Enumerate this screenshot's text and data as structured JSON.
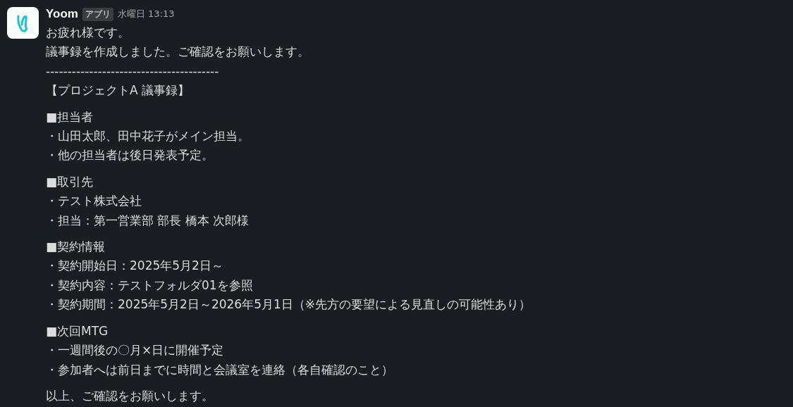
{
  "message": {
    "sender": "Yoom",
    "badge": "アプリ",
    "timestamp": "水曜日 13:13",
    "blocks": [
      {
        "lines": [
          "お疲れ様です。",
          "議事録を作成しました。ご確認をお願いします。",
          "----------------------------------------",
          "【プロジェクトA 議事録】"
        ]
      },
      {
        "lines": [
          "■担当者",
          "・山田太郎、田中花子がメイン担当。",
          "・他の担当者は後日発表予定。"
        ]
      },
      {
        "lines": [
          "■取引先",
          "・テスト株式会社",
          "・担当：第一営業部 部長 橋本 次郎様"
        ]
      },
      {
        "lines": [
          "■契約情報",
          "・契約開始日：2025年5月2日～",
          "・契約内容：テストフォルダ01を参照",
          "・契約期間：2025年5月2日～2026年5月1日（※先方の要望による見直しの可能性あり）"
        ]
      },
      {
        "lines": [
          "■次回MTG",
          "・一週間後の〇月×日に開催予定",
          "・参加者へは前日までに時間と会議室を連絡（各自確認のこと）"
        ]
      },
      {
        "lines": [
          "以上、ご確認をお願いします。"
        ]
      }
    ]
  }
}
